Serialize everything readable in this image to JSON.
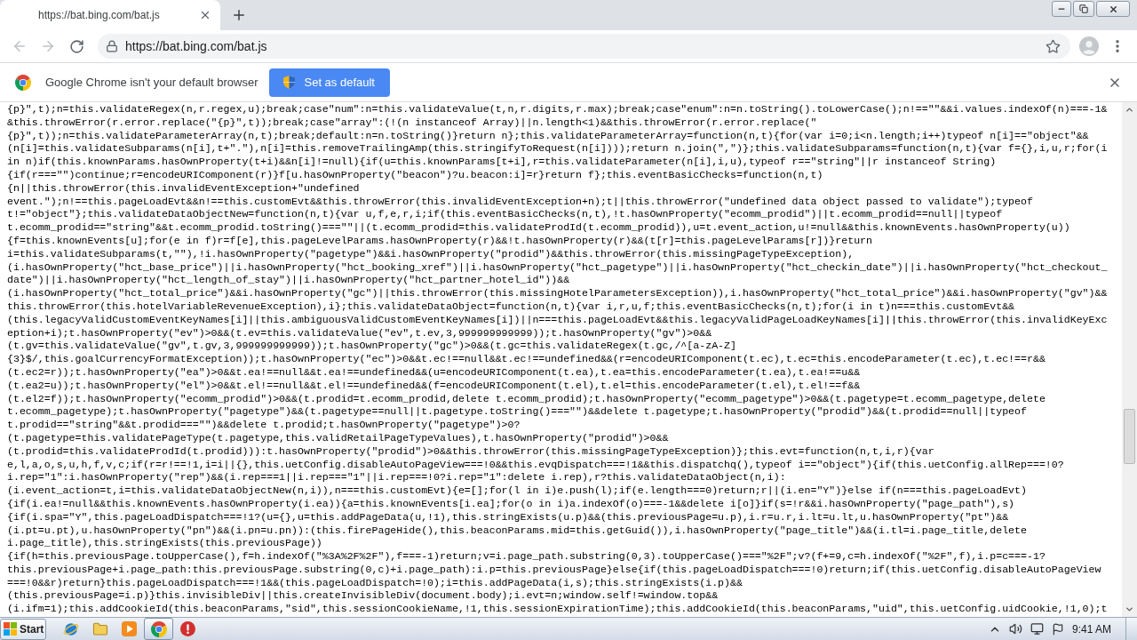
{
  "tabs": [
    {
      "title": "https://bat.bing.com/bat.js",
      "selected": true
    }
  ],
  "toolbar": {
    "back": {
      "disabled": true
    },
    "forward": {
      "disabled": true
    },
    "url": "https://bat.bing.com/bat.js"
  },
  "infobar": {
    "message": "Google Chrome isn't your default browser",
    "button": "Set as default"
  },
  "code_lines": [
    "{p}\",t);n=this.validateRegex(n,r.regex,u);break;case\"num\":n=this.validateValue(t,n,r.digits,r.max);break;case\"enum\":n=n.toString().toLowerCase();n!==\"\"&&i.values.indexOf(n)===-1&",
    "&this.throwError(r.error.replace(\"{p}\",t));break;case\"array\":(!(n instanceof Array)||n.length<1)&&this.throwError(r.error.replace(\"",
    "{p}\",t));n=this.validateParameterArray(n,t);break;default:n=n.toString()}return n};this.validateParameterArray=function(n,t){for(var i=0;i<n.length;i++)typeof n[i]==\"object\"&&",
    "(n[i]=this.validateSubparams(n[i],t+\".\"),n[i]=this.removeTrailingAmp(this.stringifyToRequest(n[i])));return n.join(\",\")};this.validateSubparams=function(n,t){var f={},i,u,r;for(i",
    "in n)if(this.knownParams.hasOwnProperty(t+i)&&n[i]!=null){if(u=this.knownParams[t+i],r=this.validateParameter(n[i],i,u),typeof r==\"string\"||r instanceof String)",
    "{if(r===\"\")continue;r=encodeURIComponent(r)}f[u.hasOwnProperty(\"beacon\")?u.beacon:i]=r}return f};this.eventBasicChecks=function(n,t)",
    "{n||this.throwError(this.invalidEventException+\"undefined",
    "event.\");n!==this.pageLoadEvt&&n!==this.customEvt&&this.throwError(this.invalidEventException+n);t||this.throwError(\"undefined data object passed to validate\");typeof",
    "t!=\"object\"};this.validateDataObjectNew=function(n,t){var u,f,e,r,i;if(this.eventBasicChecks(n,t),!t.hasOwnProperty(\"ecomm_prodid\")||t.ecomm_prodid==null||typeof",
    "t.ecomm_prodid==\"string\"&&t.ecomm_prodid.toString()===\"\"||(t.ecomm_prodid=this.validateProdId(t.ecomm_prodid)),u=t.event_action,u!=null&&this.knownEvents.hasOwnProperty(u))",
    "{f=this.knownEvents[u];for(e in f)r=f[e],this.pageLevelParams.hasOwnProperty(r)&&!t.hasOwnProperty(r)&&(t[r]=this.pageLevelParams[r])}return",
    "i=this.validateSubparams(t,\"\"),!i.hasOwnProperty(\"pagetype\")&&i.hasOwnProperty(\"prodid\")&&this.throwError(this.missingPageTypeException),",
    "(i.hasOwnProperty(\"hct_base_price\")||i.hasOwnProperty(\"hct_booking_xref\")||i.hasOwnProperty(\"hct_pagetype\")||i.hasOwnProperty(\"hct_checkin_date\")||i.hasOwnProperty(\"hct_checkout_",
    "date\")||i.hasOwnProperty(\"hct_length_of_stay\")||i.hasOwnProperty(\"hct_partner_hotel_id\"))&&",
    "(i.hasOwnProperty(\"hct_total_price\")&&i.hasOwnProperty(\"gc\")||this.throwError(this.missingHotelParametersException)),i.hasOwnProperty(\"hct_total_price\")&&i.hasOwnProperty(\"gv\")&&",
    "this.throwError(this.hotelVariableRevenueException),i};this.validateDataObject=function(n,t){var i,r,u,f;this.eventBasicChecks(n,t);for(i in t)n===this.customEvt&&",
    "(this.legacyValidCustomEventKeyNames[i]||this.ambiguousValidCustomEventKeyNames[i])||n===this.pageLoadEvt&&this.legacyValidPageLoadKeyNames[i]||this.throwError(this.invalidKeyExc",
    "eption+i);t.hasOwnProperty(\"ev\")>0&&(t.ev=this.validateValue(\"ev\",t.ev,3,999999999999));t.hasOwnProperty(\"gv\")>0&&",
    "(t.gv=this.validateValue(\"gv\",t.gv,3,999999999999));t.hasOwnProperty(\"gc\")>0&&(t.gc=this.validateRegex(t.gc,/^[a-zA-Z]",
    "{3}$/,this.goalCurrencyFormatException));t.hasOwnProperty(\"ec\")>0&&t.ec!==null&&t.ec!==undefined&&(r=encodeURIComponent(t.ec),t.ec=this.encodeParameter(t.ec),t.ec!==r&&",
    "(t.ec2=r));t.hasOwnProperty(\"ea\")>0&&t.ea!==null&&t.ea!==undefined&&(u=encodeURIComponent(t.ea),t.ea=this.encodeParameter(t.ea),t.ea!==u&&",
    "(t.ea2=u));t.hasOwnProperty(\"el\")>0&&t.el!==null&&t.el!==undefined&&(f=encodeURIComponent(t.el),t.el=this.encodeParameter(t.el),t.el!==f&&",
    "(t.el2=f));t.hasOwnProperty(\"ecomm_prodid\")>0&&(t.prodid=t.ecomm_prodid,delete t.ecomm_prodid);t.hasOwnProperty(\"ecomm_pagetype\")>0&&(t.pagetype=t.ecomm_pagetype,delete",
    "t.ecomm_pagetype);t.hasOwnProperty(\"pagetype\")&&(t.pagetype==null||t.pagetype.toString()===\"\")&&delete t.pagetype;t.hasOwnProperty(\"prodid\")&&(t.prodid==null||typeof",
    "t.prodid==\"string\"&&t.prodid===\"\")&&delete t.prodid;t.hasOwnProperty(\"pagetype\")>0?",
    "(t.pagetype=this.validatePageType(t.pagetype,this.validRetailPageTypeValues),t.hasOwnProperty(\"prodid\")>0&&",
    "(t.prodid=this.validateProdId(t.prodid))):t.hasOwnProperty(\"prodid\")>0&&this.throwError(this.missingPageTypeException)};this.evt=function(n,t,i,r){var",
    "e,l,a,o,s,u,h,f,v,c;if(r=r!==!1,i=i||{},this.uetConfig.disableAutoPageView===!0&&this.evqDispatch===!1&&this.dispatchq(),typeof i==\"object\"){if(this.uetConfig.allRep===!0?",
    "i.rep=\"1\":i.hasOwnProperty(\"rep\")&&(i.rep===1||i.rep===\"1\"||i.rep===!0?i.rep=\"1\":delete i.rep),r?this.validateDataObject(n,i):",
    "(i.event_action=t,i=this.validateDataObjectNew(n,i)),n===this.customEvt){e=[];for(l in i)e.push(l);if(e.length===0)return;r||(i.en=\"Y\")}else if(n===this.pageLoadEvt)",
    "{if(i.ea!=null&&this.knownEvents.hasOwnProperty(i.ea)){a=this.knownEvents[i.ea];for(o in i)a.indexOf(o)===-1&&delete i[o]}if(s=!r&&i.hasOwnProperty(\"page_path\"),s)",
    "{if(i.spa=\"Y\",this.pageLoadDispatch===!1?(u={},u=this.addPageData(u,!1),this.stringExists(u.p)&&(this.previousPage=u.p),i.r=u.r,i.lt=u.lt,u.hasOwnProperty(\"pt\")&&",
    "(i.pt=u.pt),u.hasOwnProperty(\"pn\")&&(i.pn=u.pn)):(this.firePageHide(),this.beaconParams.mid=this.getGuid()),i.hasOwnProperty(\"page_title\")&&(i.tl=i.page_title,delete",
    "i.page_title),this.stringExists(this.previousPage))",
    "{if(h=this.previousPage.toUpperCase(),f=h.indexOf(\"%3A%2F%2F\"),f===-1)return;v=i.page_path.substring(0,3).toUpperCase()===\"%2F\";v?(f+=9,c=h.indexOf(\"%2F\",f),i.p=c===-1?",
    "this.previousPage+i.page_path:this.previousPage.substring(0,c)+i.page_path):i.p=this.previousPage}else{if(this.pageLoadDispatch===!0)return;if(this.uetConfig.disableAutoPageView",
    "===!0&&r)return}this.pageLoadDispatch===!1&&(this.pageLoadDispatch=!0);i=this.addPageData(i,s);this.stringExists(i.p)&&",
    "(this.previousPage=i.p)}this.invisibleDiv||this.createInvisibleDiv(document.body);i.evt=n;window.self!=window.top&&",
    "(i.ifm=1);this.addCookieId(this.beaconParams,\"sid\",this.sessionCookieName,!1,this.sessionExpirationTime);this.addCookieId(this.beaconParams,\"uid\",this.uetConfig.uidCookie,!1,0);t"
  ],
  "taskbar": {
    "start": "Start",
    "pinned": [
      {
        "kind": "globe",
        "running": false
      },
      {
        "kind": "folder",
        "running": false
      },
      {
        "kind": "player",
        "running": false
      },
      {
        "kind": "browser",
        "running": true
      },
      {
        "kind": "alert",
        "running": false
      }
    ],
    "clock": "9:41 AM"
  }
}
